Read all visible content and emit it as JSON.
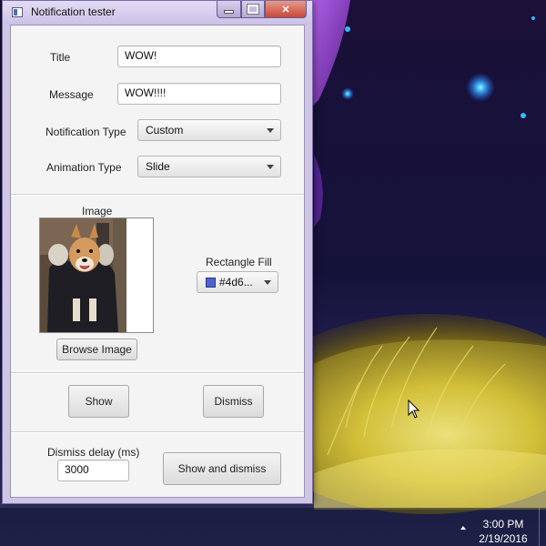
{
  "window": {
    "title": "Notification tester",
    "close_glyph": "✕"
  },
  "form": {
    "title_label": "Title",
    "title_value": "WOW!",
    "message_label": "Message",
    "message_value": "WOW!!!!",
    "notification_type_label": "Notification Type",
    "notification_type_value": "Custom",
    "animation_type_label": "Animation Type",
    "animation_type_value": "Slide"
  },
  "image_section": {
    "label": "Image",
    "browse_button": "Browse Image",
    "fill_label": "Rectangle Fill",
    "fill_value": "#4d6...",
    "fill_color": "#4d62d0"
  },
  "actions": {
    "show_button": "Show",
    "dismiss_button": "Dismiss"
  },
  "delay": {
    "label": "Dismiss delay (ms)",
    "value": "3000",
    "show_and_dismiss_button": "Show and dismiss"
  },
  "taskbar": {
    "time": "3:00 PM",
    "date": "2/19/2016"
  },
  "icons": [
    "app-icon",
    "minimize-icon",
    "maximize-icon",
    "close-icon",
    "chevron-down-icon",
    "color-swatch-icon",
    "tray-up-arrow-icon",
    "mouse-pointer-icon"
  ]
}
